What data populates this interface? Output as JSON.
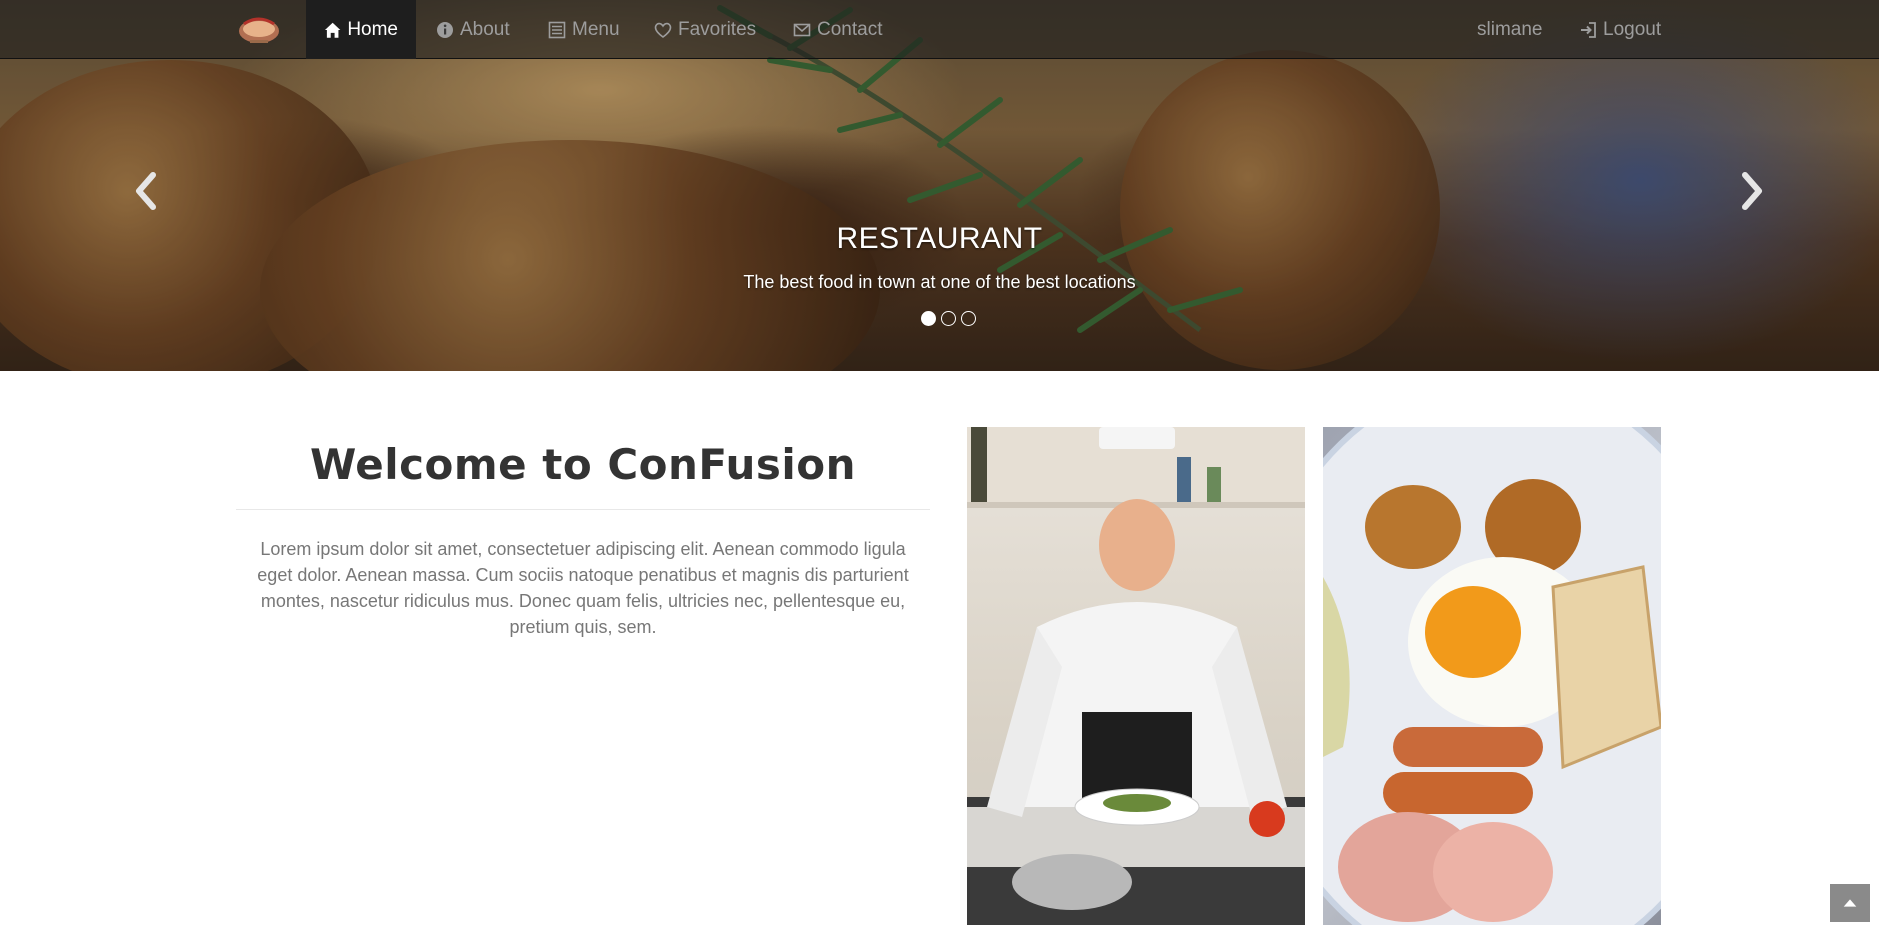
{
  "navbar": {
    "brand_logo": "restaurant-logo",
    "items": [
      {
        "label": "Home",
        "icon": "home-icon",
        "active": true
      },
      {
        "label": "About",
        "icon": "info-circle-icon",
        "active": false
      },
      {
        "label": "Menu",
        "icon": "list-alt-icon",
        "active": false
      },
      {
        "label": "Favorites",
        "icon": "heart-icon",
        "active": false
      },
      {
        "label": "Contact",
        "icon": "envelope-icon",
        "active": false
      }
    ],
    "user": "slimane",
    "logout": {
      "label": "Logout",
      "icon": "sign-in-icon"
    }
  },
  "carousel": {
    "title": "RESTAURANT",
    "subtitle": "The best food in town at one of the best locations",
    "slide_count": 3,
    "active_slide": 1,
    "prev_icon": "chevron-left-icon",
    "next_icon": "chevron-right-icon"
  },
  "welcome": {
    "title": "Welcome to ConFusion",
    "text": "Lorem ipsum dolor sit amet, consectetuer adipiscing elit. Aenean commodo ligula eget dolor. Aenean massa. Cum sociis natoque penatibus et magnis dis parturient montes, nascetur ridiculus mus. Donec quam felis, ultricies nec, pellentesque eu, pretium quis, sem."
  },
  "images": [
    {
      "name": "chef-photo"
    },
    {
      "name": "breakfast-plate-photo"
    }
  ],
  "scroll_top_icon": "chevron-up-icon",
  "colors": {
    "navbar_bg": "#1e1e1e",
    "nav_text": "#9d9d9d",
    "nav_active_text": "#ffffff",
    "body_text": "#777777",
    "heading_text": "#333333"
  }
}
